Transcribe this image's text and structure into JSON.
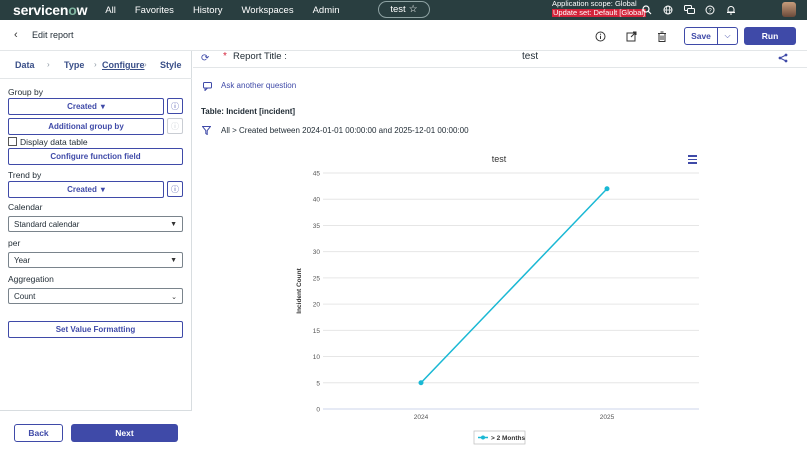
{
  "topnav": {
    "logo_prefix": "servicen",
    "logo_o": "o",
    "logo_suffix": "w",
    "menu": [
      "All",
      "Favorites",
      "History",
      "Workspaces",
      "Admin"
    ],
    "pill_label": "test",
    "scope_line1": "Application scope: Global",
    "scope_line2": "Update set: Default [Global]",
    "icons": [
      "search-icon",
      "globe-icon",
      "chat-icon",
      "help-icon",
      "bell-icon"
    ]
  },
  "subheader": {
    "title": "Edit report",
    "save_label": "Save",
    "run_label": "Run",
    "icons": [
      "info-icon",
      "export-icon",
      "trash-icon"
    ]
  },
  "steps": [
    "Data",
    "Type",
    "Configure",
    "Style"
  ],
  "active_step": "Configure",
  "config": {
    "group_by_label": "Group by",
    "group_by_value": "Created",
    "additional_group_label": "Additional group by",
    "display_data_table_label": "Display data table",
    "display_data_table_checked": false,
    "configure_function_label": "Configure function field",
    "trend_by_label": "Trend by",
    "trend_by_value": "Created",
    "calendar_label": "Calendar",
    "calendar_value": "Standard calendar",
    "per_label": "per",
    "per_value": "Year",
    "aggregation_label": "Aggregation",
    "aggregation_value": "Count",
    "set_value_formatting_label": "Set Value Formatting"
  },
  "footer": {
    "back_label": "Back",
    "next_label": "Next"
  },
  "report": {
    "title_label": "Report Title :",
    "title_value": "test",
    "ask_label": "Ask another question",
    "table_label": "Table: Incident [incident]",
    "filter_text": "All  >  Created between 2024-01-01 00:00:00 and 2025-12-01 00:00:00"
  },
  "colors": {
    "primary": "#3f4aa8",
    "nav": "#293e40",
    "series": "#1ab8d4",
    "required": "#d4243b"
  },
  "chart_data": {
    "type": "line",
    "title": "test",
    "xlabel": "",
    "ylabel": "Incident Count",
    "categories": [
      "2024",
      "2025"
    ],
    "series": [
      {
        "name": "> 2 Months",
        "values": [
          5,
          42
        ]
      }
    ],
    "ylim": [
      0,
      45
    ],
    "yticks": [
      0,
      5,
      10,
      15,
      20,
      25,
      30,
      35,
      40,
      45
    ],
    "grid": true,
    "legend": "bottom-center"
  }
}
